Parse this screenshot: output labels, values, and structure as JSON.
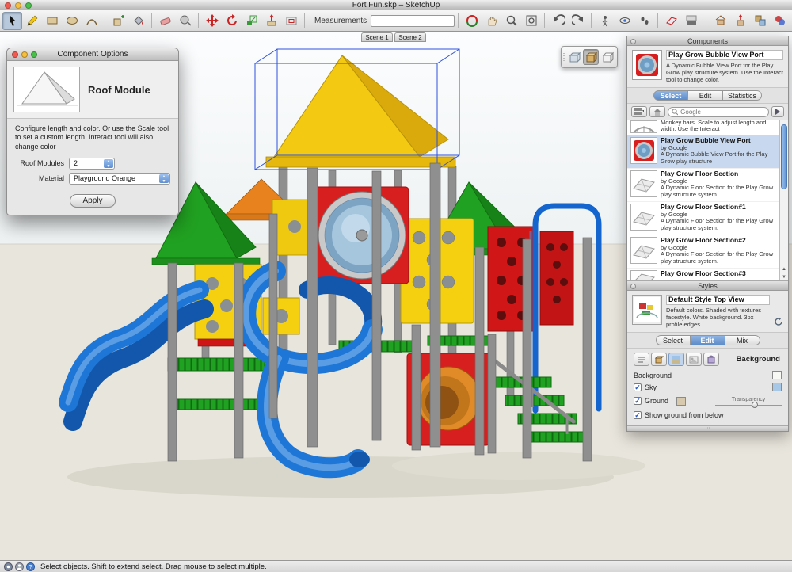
{
  "window": {
    "title": "Fort Fun.skp – SketchUp"
  },
  "toolbar": {
    "measurements_label": "Measurements",
    "measurements_value": ""
  },
  "scene_tabs": {
    "tabs": [
      "Scene 1",
      "Scene 2"
    ]
  },
  "component_options": {
    "title": "Component Options",
    "heading": "Roof Module",
    "description": "Configure length and color.  Or use the Scale tool to set a custom length.  Interact tool will also change color",
    "fields": {
      "roof_modules": {
        "label": "Roof Modules",
        "value": "2"
      },
      "material": {
        "label": "Material",
        "value": "Playground Orange"
      }
    },
    "apply_label": "Apply"
  },
  "components_panel": {
    "title": "Components",
    "preview": {
      "name": "Play Grow Bubble View Port",
      "description": "A Dynamic Bubble View Port for the Play Grow play structure system.  Use the Interact tool to change color."
    },
    "tabs": [
      "Select",
      "Edit",
      "Statistics"
    ],
    "active_tab": "Select",
    "search_placeholder": "Google",
    "list": [
      {
        "name": "",
        "by": "",
        "description": "Monkey bars.  Scale to adjust length and width.  Use the Interact"
      },
      {
        "name": "Play Grow Bubble View Port",
        "by": "by Google",
        "description": "A Dynamic Bubble View Port  for the Play Grow play structure",
        "selected": true
      },
      {
        "name": "Play Grow Floor Section",
        "by": "by Google",
        "description": "A Dynamic Floor Section for the Play Grow play structure system."
      },
      {
        "name": "Play Grow Floor Section#1",
        "by": "by Google",
        "description": "A Dynamic Floor Section for the Play Grow play structure system."
      },
      {
        "name": "Play Grow Floor Section#2",
        "by": "by Google",
        "description": "A Dynamic Floor Section for the Play Grow play structure system."
      },
      {
        "name": "Play Grow Floor Section#3",
        "by": "",
        "description": ""
      }
    ]
  },
  "styles_panel": {
    "title": "Styles",
    "preview": {
      "name": "Default Style Top View",
      "description": "Default colors.  Shaded with textures facestyle.  White background.  3px profile edges."
    },
    "tabs": [
      "Select",
      "Edit",
      "Mix"
    ],
    "active_tab": "Edit",
    "section_label": "Background",
    "rows": {
      "background": {
        "label": "Background",
        "mark": ""
      },
      "sky": {
        "label": "Sky",
        "mark": "✓"
      },
      "ground": {
        "label": "Ground",
        "mark": "✓"
      },
      "show_ground": {
        "label": "Show ground from below",
        "mark": "✓"
      }
    },
    "transparency_label": "Transparency"
  },
  "status_bar": {
    "message": "Select objects. Shift to extend select. Drag mouse to select multiple."
  },
  "colors": {
    "selection_blue": "#2b50e0",
    "active_tab_blue": "#5d8cc8",
    "slide_blue": "#1e77d6",
    "panel_red": "#d81f1f",
    "panel_yellow": "#f4d010",
    "roof_green": "#21a121",
    "roof_yellow": "#f3c912",
    "roof_orange": "#e8821e",
    "tunnel_orange": "#e08b28",
    "post_gray": "#8f8f8f",
    "sky": "#f7f9fa",
    "ground": "#e8e5dc"
  },
  "icons": {
    "toolbar": [
      "select",
      "line",
      "rectangle",
      "circle",
      "arc",
      "make-component",
      "paint-bucket",
      "eraser",
      "tape-measure",
      "move",
      "rotate",
      "scale",
      "push-pull",
      "offset",
      "orbit",
      "pan",
      "zoom",
      "zoom-window",
      "zoom-extents",
      "previous-view",
      "next-view",
      "position-camera",
      "look-around",
      "walk",
      "section-plane",
      "shadows",
      "get-models",
      "share-model",
      "components-window",
      "styles-window"
    ],
    "face_style_palette": [
      "xray-cube",
      "shaded-textures-cube",
      "monochrome-cube"
    ],
    "search": "magnifier",
    "collections": "grid-dropdown",
    "home": "house",
    "details": "arrow",
    "status": [
      "geolocation",
      "credits",
      "help"
    ]
  }
}
